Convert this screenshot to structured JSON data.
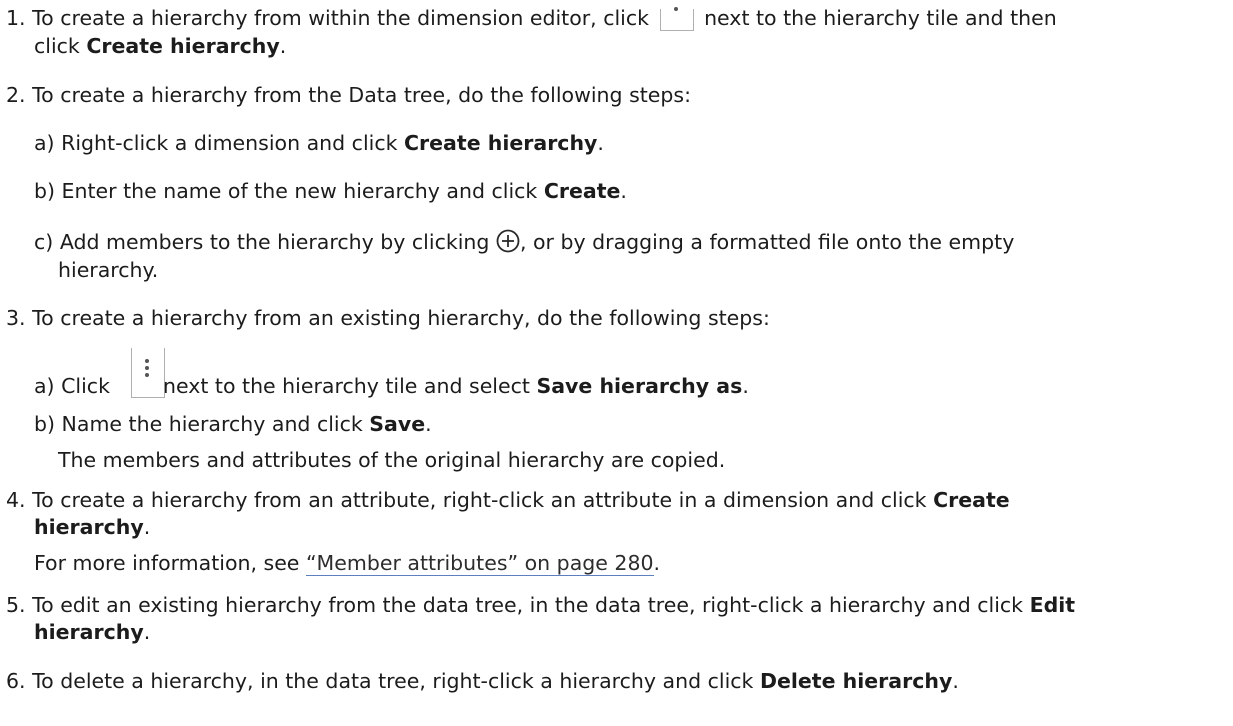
{
  "steps": [
    {
      "num": "1.",
      "l1_a": "To create a hierarchy from within the dimension editor, click",
      "l1_b": "next to the hierarchy tile and then",
      "l2_a": "click ",
      "l2_bold": "Create hierarchy",
      "l2_end": "."
    },
    {
      "num": "2.",
      "text": "To create a hierarchy from the Data tree, do the following steps:",
      "a": {
        "label": "a)",
        "text": "Right-click a dimension and click ",
        "bold": "Create hierarchy",
        "end": "."
      },
      "b": {
        "label": "b)",
        "text": "Enter the name of the new hierarchy and click ",
        "bold": "Create",
        "end": "."
      },
      "c": {
        "label": "c)",
        "text1": "Add members to the hierarchy by clicking",
        "text2": ", or by dragging a formatted file onto the empty",
        "text3": "hierarchy."
      }
    },
    {
      "num": "3.",
      "text": "To create a hierarchy from an existing hierarchy, do the following steps:",
      "a": {
        "label": "a)",
        "text1": "Click",
        "text2": " next to the hierarchy tile and select ",
        "bold": "Save hierarchy as",
        "end": "."
      },
      "b": {
        "label": "b)",
        "text": "Name the hierarchy and click ",
        "bold": "Save",
        "end": "."
      },
      "note": "The members and attributes of the original hierarchy are copied."
    },
    {
      "num": "4.",
      "l1": "To create a hierarchy from an attribute, right-click an attribute in a dimension and click ",
      "l1_bold": "Create",
      "l2_bold": "hierarchy",
      "l2_end": ".",
      "more_a": "For more information, see ",
      "link": "“Member attributes” on page 280",
      "more_end": "."
    },
    {
      "num": "5.",
      "l1": "To edit an existing hierarchy from the data tree, in the data tree, right-click a hierarchy and click ",
      "l1_bold": "Edit",
      "l2_bold": "hierarchy",
      "l2_end": "."
    },
    {
      "num": "6.",
      "l1": "To delete a hierarchy, in the data tree, right-click a hierarchy and click ",
      "l1_bold": "Delete hierarchy",
      "l1_end": "."
    }
  ],
  "icons": {
    "more_menu": "vertical-ellipsis-icon",
    "add_member": "add-circle-icon"
  }
}
